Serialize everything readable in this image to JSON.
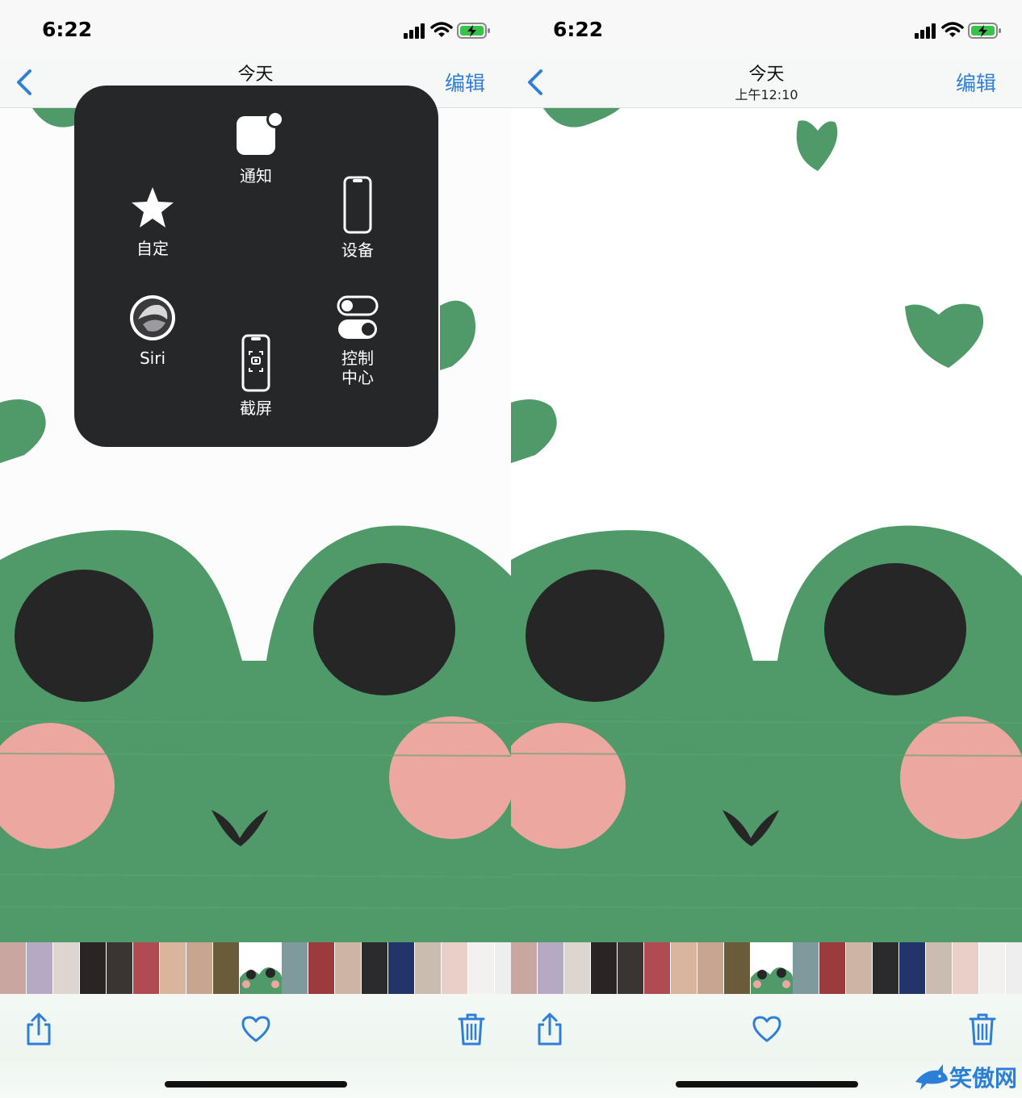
{
  "screens": [
    {
      "status": {
        "time": "6:22"
      },
      "nav": {
        "title": "今天",
        "subtitle": "",
        "edit_label": "编辑"
      },
      "assistive_menu": {
        "notification": "通知",
        "custom": "自定",
        "device": "设备",
        "siri": "Siri",
        "screenshot": "截屏",
        "control_center_line1": "控制",
        "control_center_line2": "中心"
      }
    },
    {
      "status": {
        "time": "6:22"
      },
      "nav": {
        "title": "今天",
        "subtitle": "上午12:10",
        "edit_label": "编辑"
      }
    }
  ],
  "icons": {
    "back": "chevron-left-icon",
    "share": "share-icon",
    "favorite": "heart-icon",
    "delete": "trash-icon"
  },
  "watermark": {
    "text": "笑傲网"
  },
  "colors": {
    "accent": "#2f7fd8",
    "frog_green": "#4f9a68",
    "frog_black": "#262626",
    "cheek_pink": "#eca7a1",
    "menu_bg": "#262728"
  }
}
